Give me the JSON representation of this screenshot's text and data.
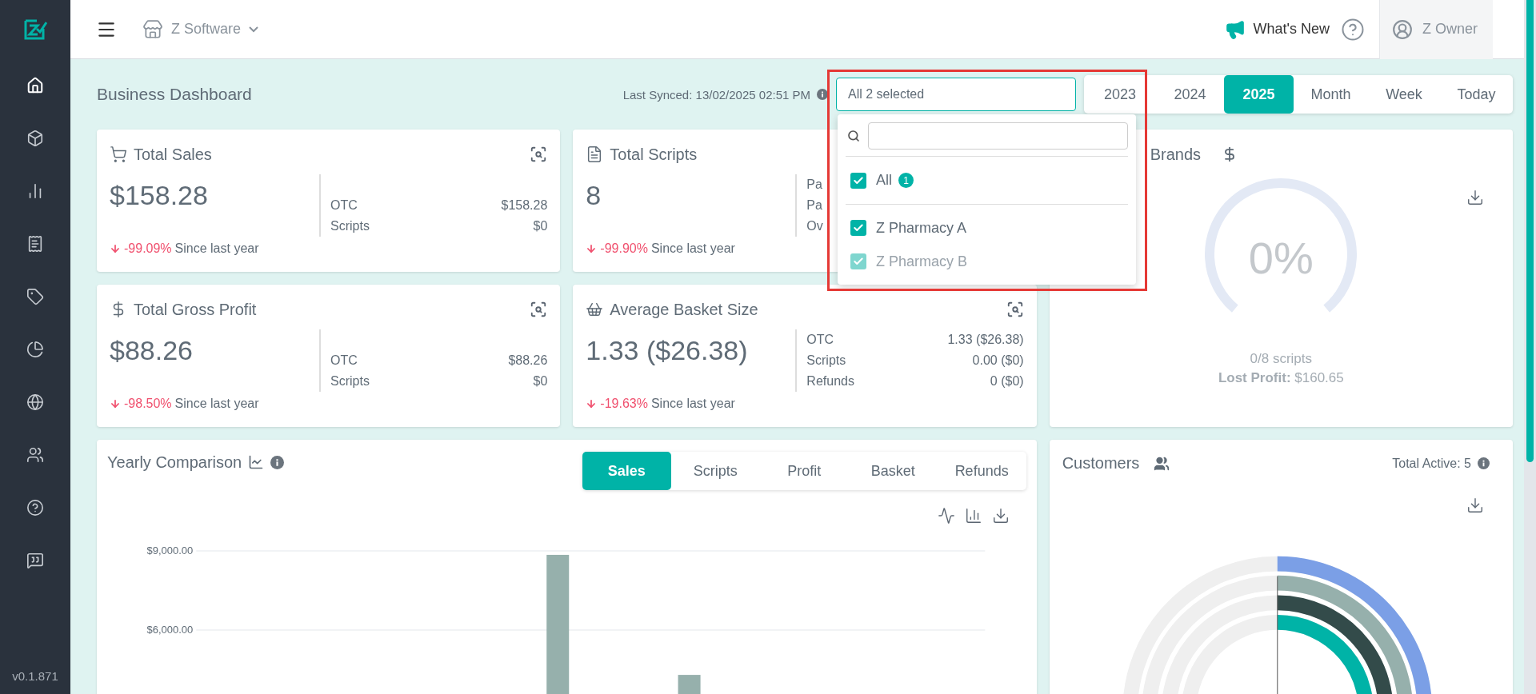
{
  "sidebar": {
    "items": [
      {
        "selected": true
      },
      {
        "selected": false
      },
      {
        "selected": false
      },
      {
        "selected": false
      },
      {
        "selected": false
      },
      {
        "selected": false
      },
      {
        "selected": false
      },
      {
        "selected": false
      },
      {
        "selected": false
      },
      {
        "selected": false
      }
    ],
    "version": "v0.1.871"
  },
  "topbar": {
    "company": "Z Software",
    "whats_new": "What's New",
    "user": "Z Owner"
  },
  "header": {
    "title": "Business Dashboard",
    "last_synced": "Last Synced: 13/02/2025 02:51 PM"
  },
  "store_select": {
    "value": "All 2 selected",
    "expanded": true,
    "options": [
      {
        "kind": "all",
        "label": "All",
        "badge": "1",
        "checked": true,
        "disabled": false
      },
      {
        "kind": "store",
        "label": "Z Pharmacy A",
        "checked": true,
        "disabled": false
      },
      {
        "kind": "store",
        "label": "Z Pharmacy B",
        "checked": true,
        "disabled": true
      }
    ]
  },
  "periods": [
    {
      "label": "2023",
      "selected": false
    },
    {
      "label": "2024",
      "selected": false
    },
    {
      "label": "2025",
      "selected": true
    },
    {
      "label": "Month",
      "selected": false
    },
    {
      "label": "Week",
      "selected": false
    },
    {
      "label": "Today",
      "selected": false
    }
  ],
  "stat_cards": [
    {
      "kind": "sales",
      "title": "Total Sales",
      "value": "$158.28",
      "zoom_button": true,
      "breakdown": [
        {
          "label": "OTC",
          "value": "$158.28"
        },
        {
          "label": "Scripts",
          "value": "$0"
        }
      ],
      "decrease": true,
      "change": "-99.09%",
      "change_note": "Since last year"
    },
    {
      "kind": "scripts",
      "title": "Total Scripts",
      "value": "8",
      "zoom_button": false,
      "breakdown": [
        {
          "label": "Pa"
        },
        {
          "label": "Pa"
        },
        {
          "label": "Ov"
        }
      ],
      "decrease": true,
      "change": "-99.90%",
      "change_note": "Since last year"
    },
    {
      "kind": "profit",
      "title": "Total Gross Profit",
      "value": "$88.26",
      "zoom_button": true,
      "breakdown": [
        {
          "label": "OTC",
          "value": "$88.26"
        },
        {
          "label": "Scripts",
          "value": "$0"
        }
      ],
      "decrease": true,
      "change": "-98.50%",
      "change_note": "Since last year"
    },
    {
      "kind": "basket",
      "title": "Average Basket Size",
      "value": "1.33 ($26.38)",
      "zoom_button": true,
      "breakdown": [
        {
          "label": "OTC",
          "value": "1.33 ($26.38)"
        },
        {
          "label": "Scripts",
          "value": "0.00 ($0)"
        },
        {
          "label": "Refunds",
          "value": "0 ($0)"
        }
      ],
      "decrease": true,
      "change": "-19.63%",
      "change_note": "Since last year"
    }
  ],
  "brands_card": {
    "title": "Brands",
    "percent": "0%",
    "scripts": "0/8 scripts",
    "lost_profit": "**Lost Profit:** $160.65"
  },
  "yearly": {
    "title": "Yearly Comparison",
    "tabs": [
      {
        "label": "Sales",
        "selected": true
      },
      {
        "label": "Scripts",
        "selected": false
      },
      {
        "label": "Profit",
        "selected": false
      },
      {
        "label": "Basket",
        "selected": false
      },
      {
        "label": "Refunds",
        "selected": false
      }
    ],
    "chart_data": {
      "type": "bar",
      "ylim": [
        0,
        9000
      ],
      "yticks": [
        {
          "value": 6000,
          "label": "$6,000.00"
        },
        {
          "value": 9000,
          "label": "$9,000.00"
        }
      ],
      "series": [
        {
          "color": "#96b0ac",
          "values": [
            null,
            null,
            null,
            null,
            null,
            8850,
            null,
            4300,
            null,
            null,
            null,
            null
          ]
        }
      ]
    }
  },
  "customers": {
    "title": "Customers",
    "total_active": "Total Active: 5"
  }
}
